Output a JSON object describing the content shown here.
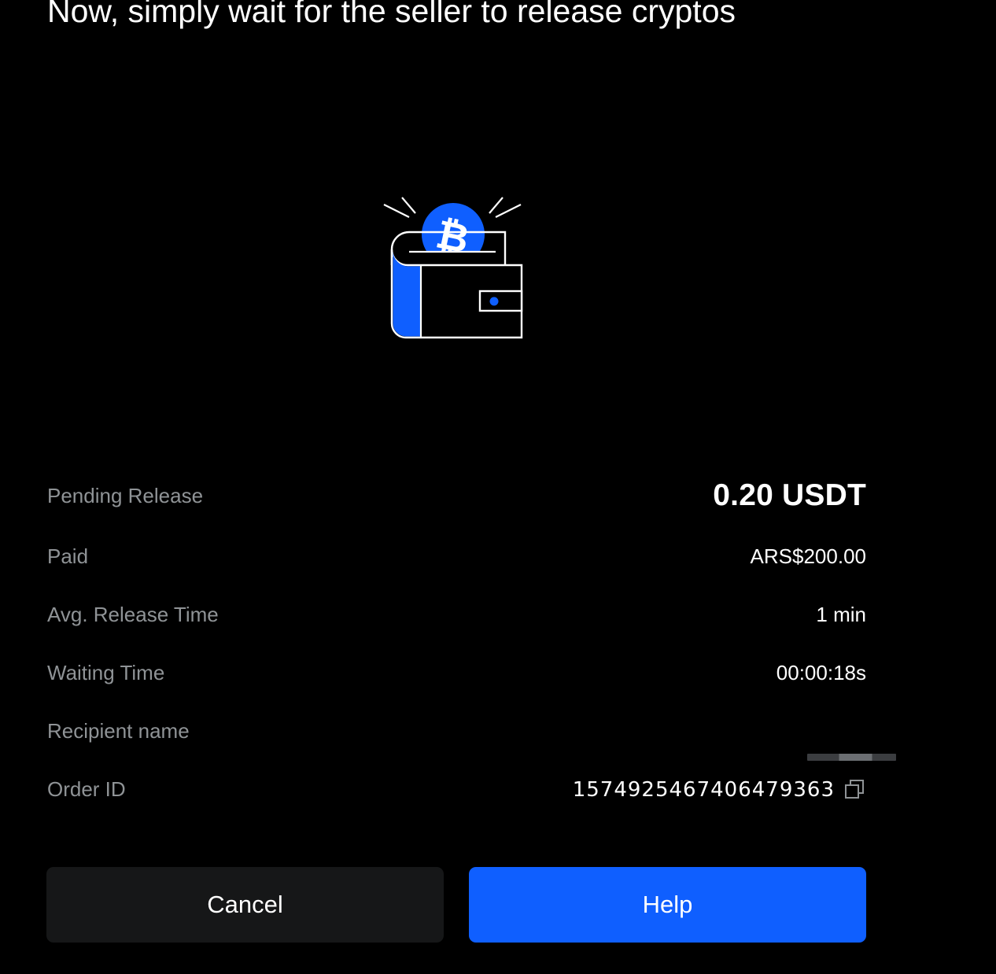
{
  "header": {
    "title": "Now, simply wait for the seller to release cryptos"
  },
  "illustration": {
    "icon": "wallet-with-bitcoin-icon",
    "accent_color": "#0f5fff"
  },
  "details": {
    "pending_release": {
      "label": "Pending Release",
      "value": "0.20 USDT"
    },
    "paid": {
      "label": "Paid",
      "value": "ARS$200.00"
    },
    "avg_release_time": {
      "label": "Avg. Release Time",
      "value": "1 min"
    },
    "waiting_time": {
      "label": "Waiting Time",
      "value": "00:00:18s"
    },
    "recipient_name": {
      "label": "Recipient name"
    },
    "order_id": {
      "label": "Order ID",
      "value": "1574925467406479363",
      "copy_icon": "copy-icon"
    }
  },
  "actions": {
    "cancel_label": "Cancel",
    "help_label": "Help"
  },
  "colors": {
    "background": "#000000",
    "label": "#8f9396",
    "primary_button": "#0f5fff",
    "secondary_button": "#161718"
  }
}
